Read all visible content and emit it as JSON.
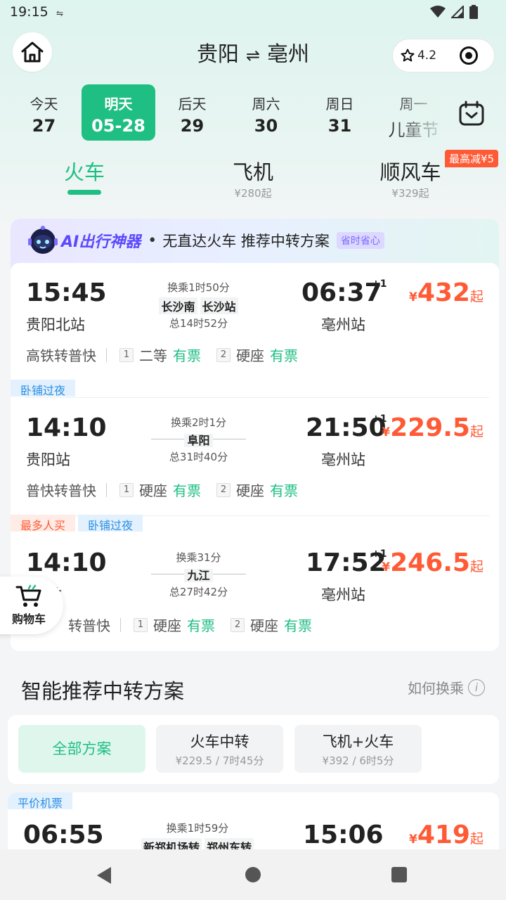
{
  "status_bar": {
    "time": "19:15",
    "download_icon": "download-speed-icon"
  },
  "header": {
    "from": "贵阳",
    "to": "亳州",
    "swap": "⇌",
    "rating": "4.2"
  },
  "dates": [
    {
      "top": "今天",
      "bottom": "27",
      "active": false
    },
    {
      "top": "明天",
      "bottom": "05-28",
      "active": true
    },
    {
      "top": "后天",
      "bottom": "29",
      "active": false
    },
    {
      "top": "周六",
      "bottom": "30",
      "active": false
    },
    {
      "top": "周日",
      "bottom": "31",
      "active": false
    },
    {
      "top": "周一",
      "bottom": "儿童节",
      "active": false
    }
  ],
  "modes": [
    {
      "label": "火车",
      "sub": ""
    },
    {
      "label": "飞机",
      "sub": "¥280起"
    },
    {
      "label": "顺风车",
      "sub": "¥329起"
    }
  ],
  "promo_badge": "最高减¥5",
  "ai": {
    "brand": "AI出行神器",
    "dot": "•",
    "text": "无直达火车 推荐中转方案",
    "tag": "省时省心"
  },
  "routes": [
    {
      "tags": [],
      "dep_time": "15:45",
      "dep_station": "贵阳北站",
      "transfer": "换乘1时50分",
      "stations": [
        "长沙南",
        "长沙站"
      ],
      "total": "总14时52分",
      "arr_time": "06:37",
      "plus": "+1",
      "arr_station": "亳州站",
      "price_symbol": "¥",
      "price": "432",
      "price_suffix": "起",
      "train_type": "高铁转普快",
      "seg1_no": "1",
      "seg1_seat": "二等",
      "seg1_status": "有票",
      "seg2_no": "2",
      "seg2_seat": "硬座",
      "seg2_status": "有票"
    },
    {
      "tags": [
        "卧铺过夜"
      ],
      "dep_time": "14:10",
      "dep_station": "贵阳站",
      "transfer": "换乘2时1分",
      "stations": [
        "阜阳"
      ],
      "total": "总31时40分",
      "arr_time": "21:50",
      "plus": "+1",
      "arr_station": "亳州站",
      "price_symbol": "¥",
      "price": "229.5",
      "price_suffix": "起",
      "train_type": "普快转普快",
      "seg1_no": "1",
      "seg1_seat": "硬座",
      "seg1_status": "有票",
      "seg2_no": "2",
      "seg2_seat": "硬座",
      "seg2_status": "有票"
    },
    {
      "tags": [
        "最多人买",
        "卧铺过夜"
      ],
      "dep_time": "14:10",
      "dep_station": "站",
      "transfer": "换乘31分",
      "stations": [
        "九江"
      ],
      "total": "总27时42分",
      "arr_time": "17:52",
      "plus": "+1",
      "arr_station": "亳州站",
      "price_symbol": "¥",
      "price": "246.5",
      "price_suffix": "起",
      "train_type": "转普快",
      "seg1_no": "1",
      "seg1_seat": "硬座",
      "seg1_status": "有票",
      "seg2_no": "2",
      "seg2_seat": "硬座",
      "seg2_status": "有票"
    }
  ],
  "cart": {
    "label": "购物车"
  },
  "smart": {
    "title": "智能推荐中转方案",
    "how": "如何换乘",
    "info_icon": "i"
  },
  "filters": [
    {
      "label": "全部方案",
      "price": "",
      "duration": "",
      "active": true
    },
    {
      "label": "火车中转",
      "price": "¥229.5",
      "duration": "7时45分",
      "active": false
    },
    {
      "label": "飞机+火车",
      "price": "¥392",
      "duration": "6时5分",
      "active": false
    }
  ],
  "filter_sep": "/",
  "bottom_route": {
    "tag": "平价机票",
    "dep_time": "06:55",
    "transfer": "换乘1时59分",
    "stations": [
      "新郑机场转",
      "郑州东转"
    ],
    "arr_time": "15:06",
    "price_symbol": "¥",
    "price": "419",
    "price_suffix": "起"
  },
  "colors": {
    "accent": "#1fbf83",
    "price": "#ff5a36",
    "ai_brand": "#5b48ff",
    "tag_blue": "#2a8de0"
  }
}
